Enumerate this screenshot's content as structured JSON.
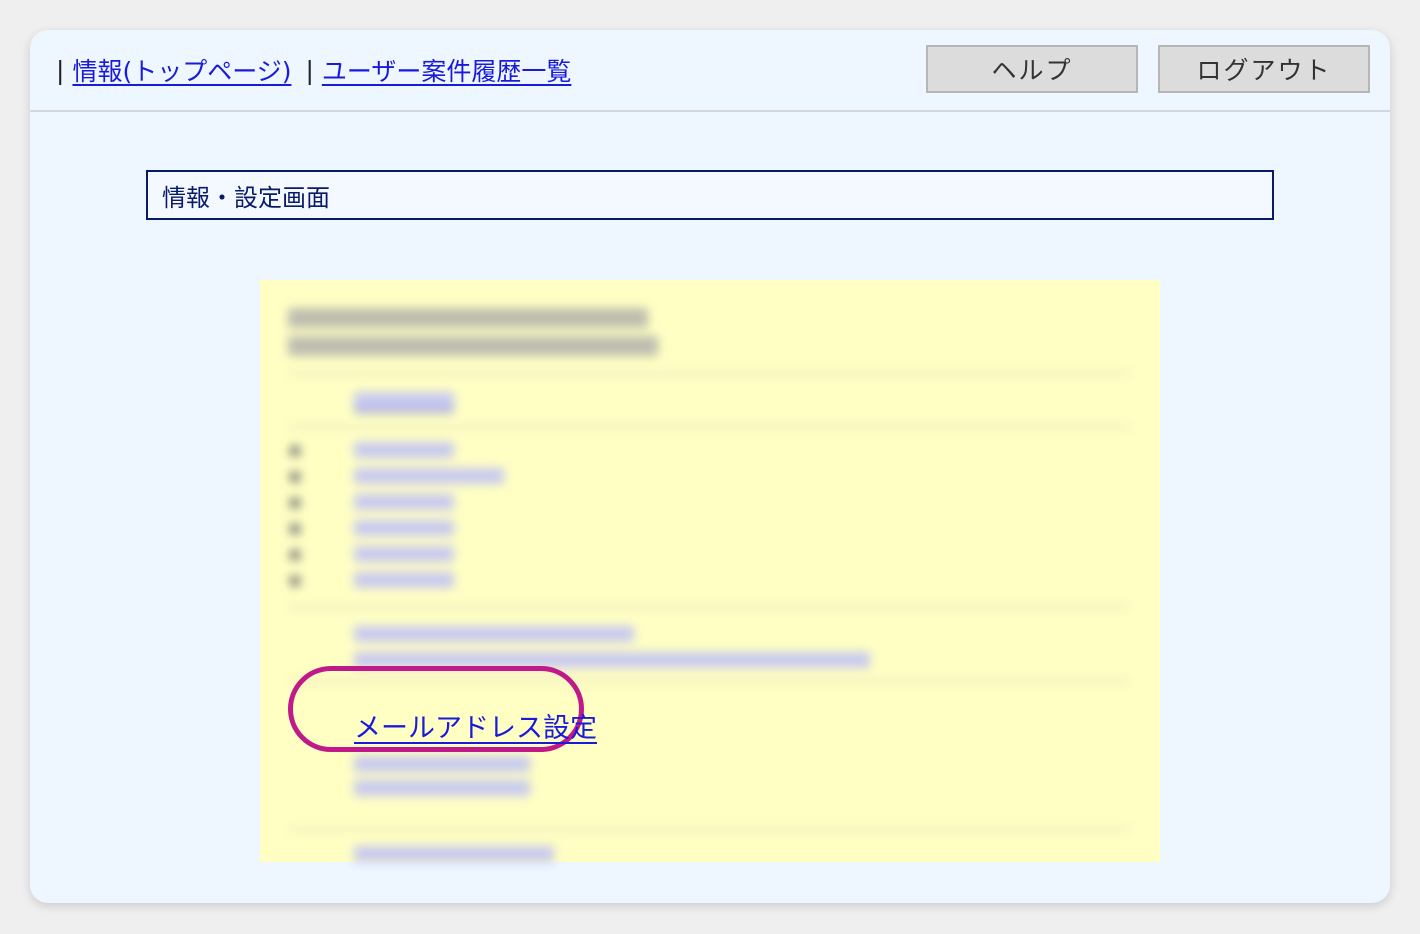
{
  "nav": {
    "sep": "|",
    "top_link": "情報(トップページ)",
    "history_link": "ユーザー案件履歴一覧"
  },
  "toolbar": {
    "help_label": "ヘルプ",
    "logout_label": "ログアウト"
  },
  "page_title": "情報・設定画面",
  "panel": {
    "highlight_color": "#c0198a",
    "mail_link": "メールアドレス設定"
  }
}
